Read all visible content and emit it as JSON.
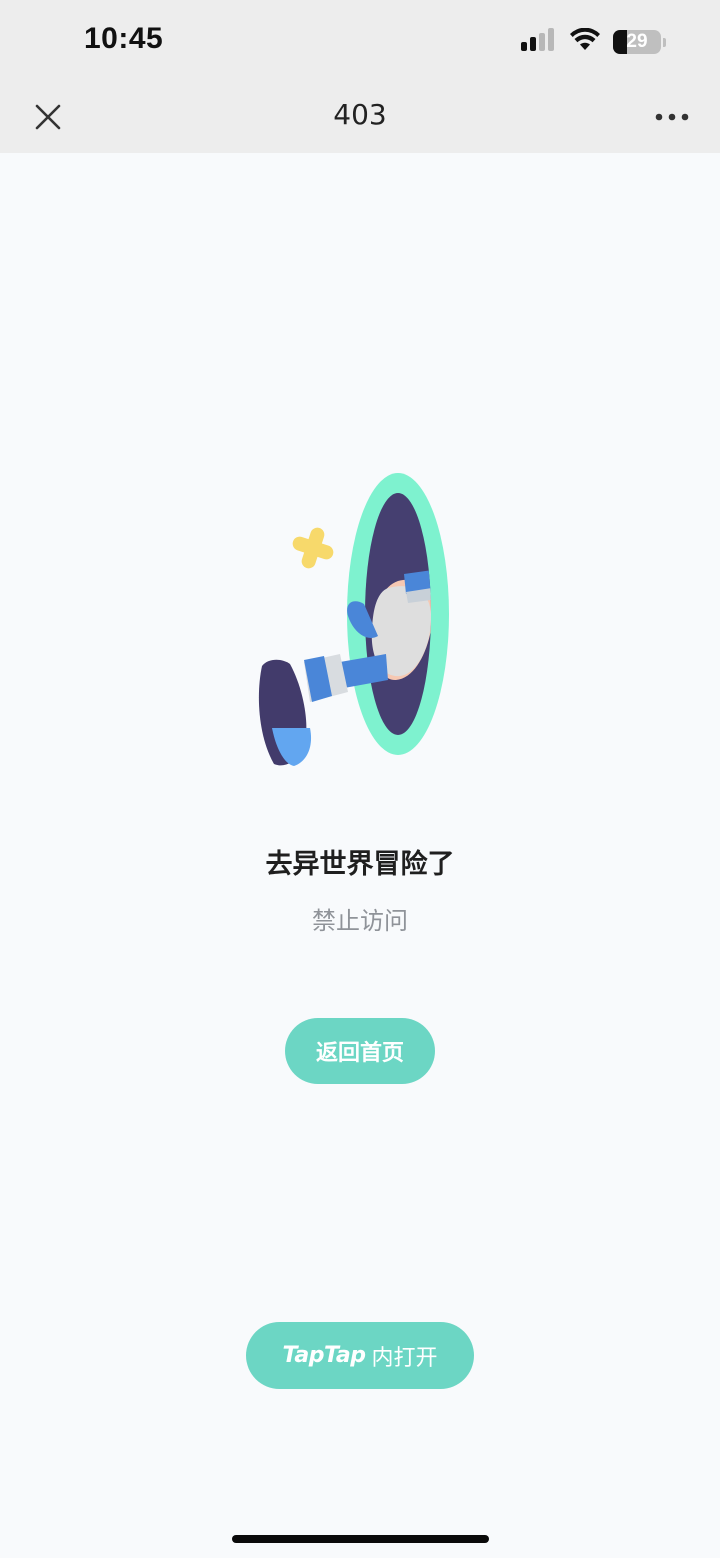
{
  "status_bar": {
    "time": "10:45",
    "battery_level": "29",
    "icons": [
      "signal-icon",
      "wifi-icon",
      "battery-icon"
    ]
  },
  "nav": {
    "title": "403",
    "left_icon": "close-icon",
    "right_icon": "more-icon"
  },
  "main": {
    "illustration": "leg-through-portal-illustration",
    "heading": "去异世界冒险了",
    "subheading": "禁止访问",
    "home_button_label": "返回首页"
  },
  "footer": {
    "open_button_brand": "TapTap",
    "open_button_label": "内打开"
  },
  "colors": {
    "accent": "#6cd6c4",
    "portal_ring": "#7ef2cf",
    "portal_inner": "#453f70",
    "page_background": "#f8fafc",
    "bar_background": "#ededed"
  }
}
